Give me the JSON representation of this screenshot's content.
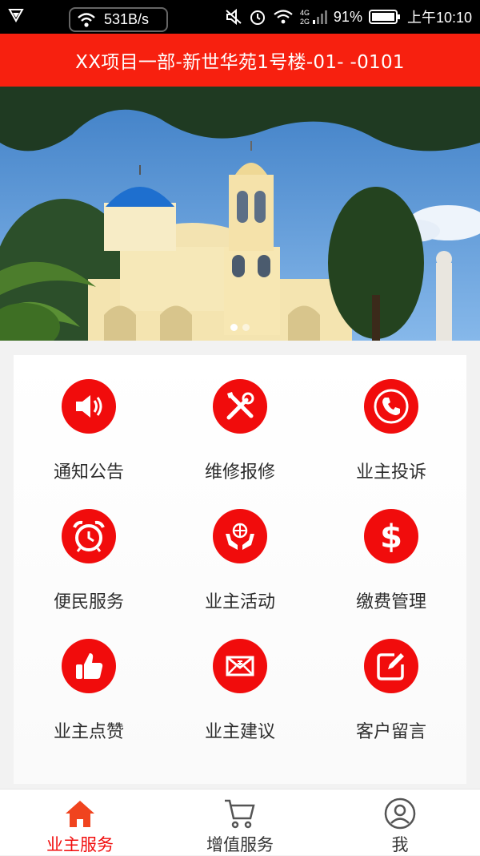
{
  "status_bar": {
    "net_speed": "531B/s",
    "network_type": "4G 2G",
    "battery": "91%",
    "time": "上午10:10"
  },
  "header": {
    "title": "XX项目一部-新世华苑1号楼-01- -0101"
  },
  "banner": {
    "dots_total": 2,
    "active_dot": 0
  },
  "services": [
    {
      "label": "通知公告",
      "icon": "speaker-icon"
    },
    {
      "label": "维修报修",
      "icon": "tools-icon"
    },
    {
      "label": "业主投诉",
      "icon": "phone-icon"
    },
    {
      "label": "便民服务",
      "icon": "alarm-clock-icon"
    },
    {
      "label": "业主活动",
      "icon": "globe-hands-icon"
    },
    {
      "label": "缴费管理",
      "icon": "dollar-icon"
    },
    {
      "label": "业主点赞",
      "icon": "thumbs-up-icon"
    },
    {
      "label": "业主建议",
      "icon": "mail-icon"
    },
    {
      "label": "客户留言",
      "icon": "edit-icon"
    }
  ],
  "tabbar": {
    "tabs": [
      {
        "label": "业主服务",
        "icon": "home-icon",
        "active": true
      },
      {
        "label": "增值服务",
        "icon": "cart-icon",
        "active": false
      },
      {
        "label": "我",
        "icon": "user-icon",
        "active": false
      }
    ]
  },
  "colors": {
    "accent": "#f10c0c",
    "header": "#f7200f"
  }
}
